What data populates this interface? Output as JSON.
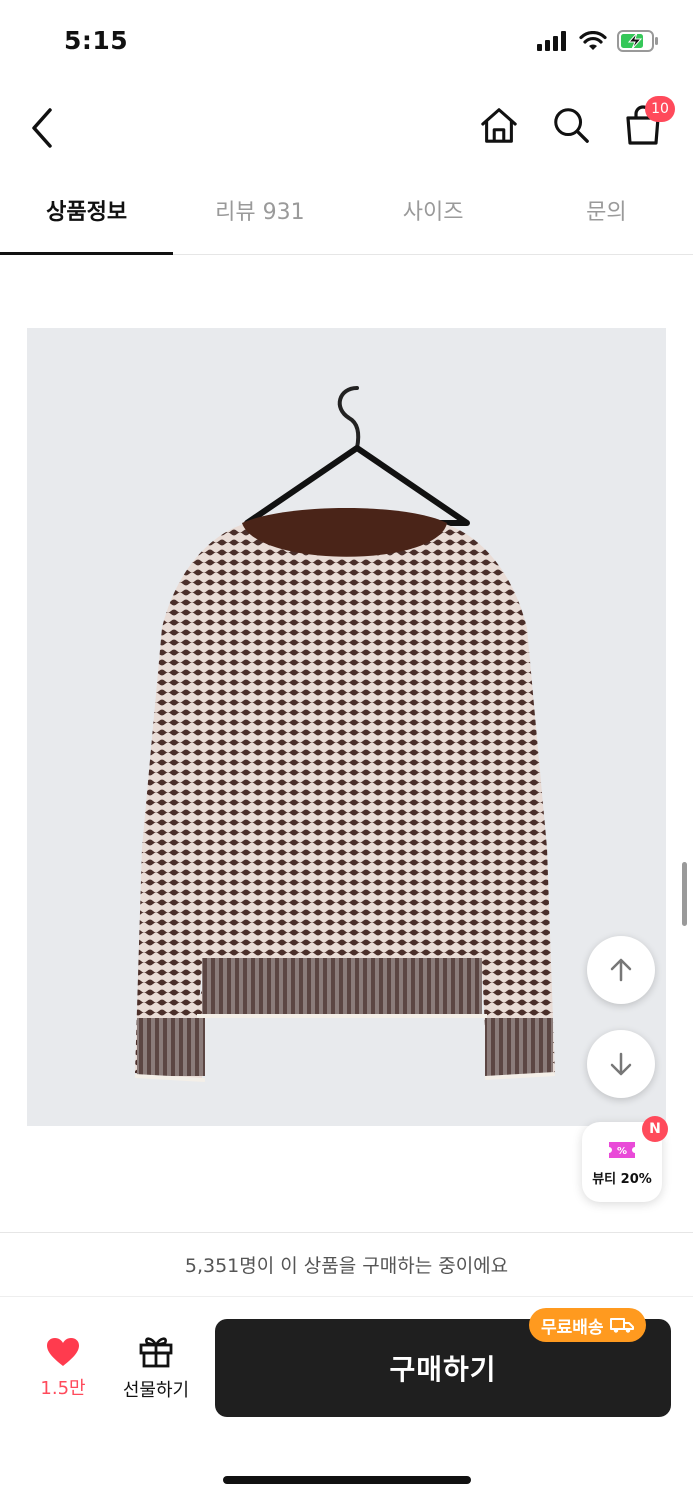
{
  "status_bar": {
    "time": "5:15"
  },
  "nav": {
    "cart_count": "10"
  },
  "tabs": [
    {
      "label": "상품정보",
      "active": true
    },
    {
      "label": "리뷰 931",
      "active": false
    },
    {
      "label": "사이즈",
      "active": false
    },
    {
      "label": "문의",
      "active": false
    }
  ],
  "floating": {
    "beauty_label": "뷰티 20%",
    "beauty_badge": "N"
  },
  "bottom": {
    "buyers_notice": "5,351명이 이 상품을 구매하는 중이에요",
    "like_count": "1.5만",
    "gift_label": "선물하기",
    "buy_label": "구매하기",
    "free_shipping": "무료배송"
  },
  "colors": {
    "accent": "#ff4a5b",
    "free_shipping": "#ff9a1f",
    "buy_button": "#1f1f1f"
  }
}
